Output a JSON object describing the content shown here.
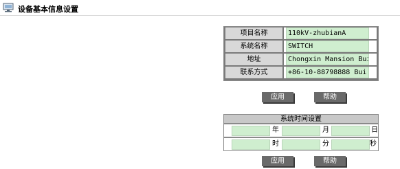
{
  "header": {
    "title": "设备基本信息设置",
    "icon": "monitor-icon"
  },
  "info": {
    "rows": [
      {
        "label": "项目名称",
        "value": "110kV-zhubianA"
      },
      {
        "label": "系统名称",
        "value": "SWITCH"
      },
      {
        "label": "地址",
        "value": "Chongxin Mansion Buil"
      },
      {
        "label": "联系方式",
        "value": "+86-10-88798888   Bui"
      }
    ],
    "apply_label": "应用",
    "help_label": "帮助"
  },
  "time": {
    "title": "系统时间设置",
    "units_row1": [
      "年",
      "月",
      "日"
    ],
    "units_row2": [
      "时",
      "分",
      "秒"
    ],
    "apply_label": "应用",
    "help_label": "帮助"
  },
  "colors": {
    "field": "#cfeecf",
    "button": "#6a6a6a",
    "label_bg": "#d8d8d8",
    "table_border": "#7a7a7a"
  }
}
